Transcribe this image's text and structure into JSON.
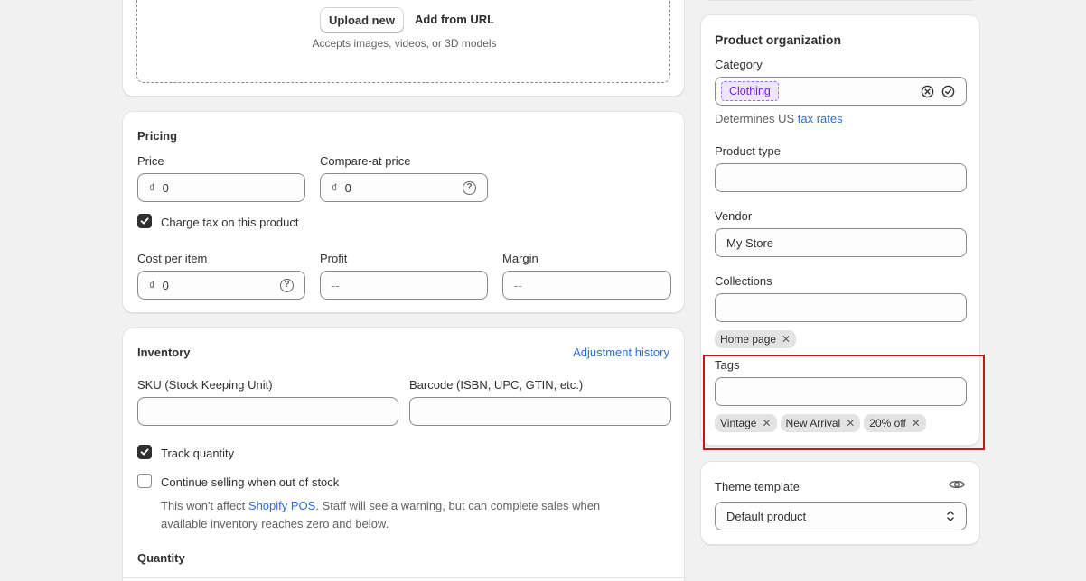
{
  "media": {
    "upload_label": "Upload new",
    "url_label": "Add from URL",
    "hint": "Accepts images, videos, or 3D models"
  },
  "pricing": {
    "title": "Pricing",
    "price_label": "Price",
    "price_value": "0",
    "compare_label": "Compare-at price",
    "compare_value": "0",
    "currency": "₫",
    "charge_tax_label": "Charge tax on this product",
    "cost_label": "Cost per item",
    "cost_value": "0",
    "profit_label": "Profit",
    "profit_value": "--",
    "margin_label": "Margin",
    "margin_value": "--"
  },
  "inventory": {
    "title": "Inventory",
    "history_link": "Adjustment history",
    "sku_label": "SKU (Stock Keeping Unit)",
    "barcode_label": "Barcode (ISBN, UPC, GTIN, etc.)",
    "track_label": "Track quantity",
    "continue_label": "Continue selling when out of stock",
    "note_before": "This won't affect ",
    "note_link": "Shopify POS",
    "note_after": ". Staff will see a warning, but can complete sales when",
    "note_line2": "available inventory reaches zero and below.",
    "quantity_title": "Quantity"
  },
  "organization": {
    "title": "Product organization",
    "category_label": "Category",
    "category_value": "Clothing",
    "category_hint_before": "Determines US ",
    "category_hint_link": "tax rates",
    "type_label": "Product type",
    "vendor_label": "Vendor",
    "vendor_value": "My Store",
    "collections_label": "Collections",
    "collection_tag": "Home page",
    "tags_label": "Tags",
    "tags": [
      "Vintage",
      "New Arrival",
      "20% off"
    ]
  },
  "theme": {
    "label": "Theme template",
    "value": "Default product"
  },
  "colors": {
    "highlight": "#c4161c",
    "link": "#2c6ecb",
    "category_pill_bg": "#eee5ff",
    "category_pill_text": "#7126d1"
  }
}
